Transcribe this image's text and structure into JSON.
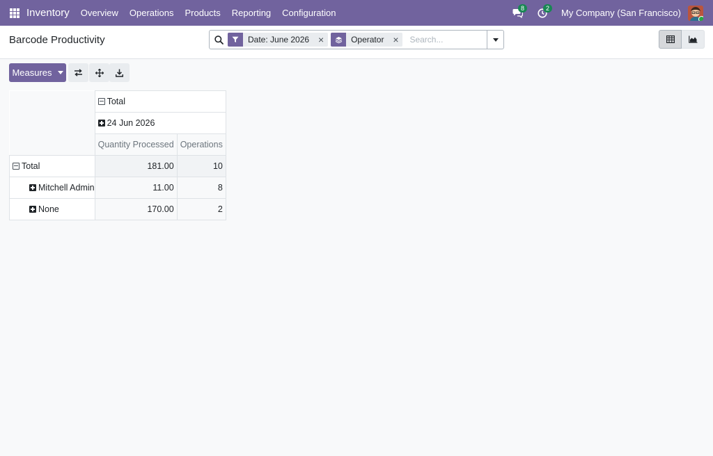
{
  "navbar": {
    "app_name": "Inventory",
    "menu": [
      "Overview",
      "Operations",
      "Products",
      "Reporting",
      "Configuration"
    ],
    "messages_count": "8",
    "activities_count": "2",
    "company": "My Company (San Francisco)"
  },
  "control_panel": {
    "title": "Barcode Productivity",
    "facets": [
      {
        "icon": "filter-icon",
        "label": "Date: June 2026"
      },
      {
        "icon": "layers-icon",
        "label": "Operator"
      }
    ],
    "search_placeholder": "Search..."
  },
  "toolbar": {
    "measures_label": "Measures"
  },
  "pivot": {
    "col_total": "Total",
    "col_group": "24 Jun 2026",
    "measures": [
      "Quantity Processed",
      "Operations"
    ],
    "rows": [
      {
        "label": "Total",
        "quantity": "181.00",
        "operations": "10"
      },
      {
        "label": "Mitchell Admin",
        "quantity": "11.00",
        "operations": "8"
      },
      {
        "label": "None",
        "quantity": "170.00",
        "operations": "2"
      }
    ]
  },
  "colors": {
    "brand": "#71639e",
    "badge": "#198754"
  }
}
